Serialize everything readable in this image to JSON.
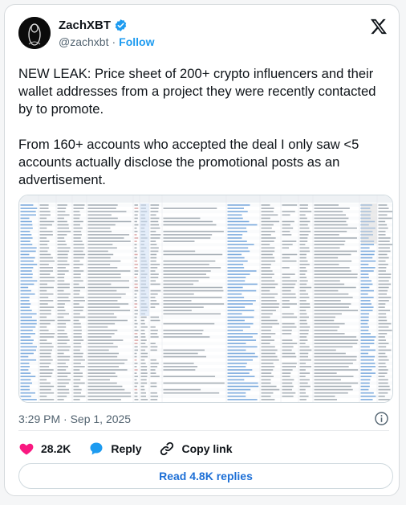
{
  "header": {
    "display_name": "ZachXBT",
    "handle": "@zachxbt",
    "separator": "·",
    "follow_label": "Follow"
  },
  "tweet": {
    "text": "NEW LEAK: Price sheet of 200+ crypto influencers and their wallet addresses from a project they were recently contacted by to promote.\n\nFrom 160+ accounts who accepted the deal I only saw <5 accounts actually disclose the promotional posts as an advertisement.",
    "timestamp": "3:29 PM · Sep 1, 2025"
  },
  "actions": {
    "likes": "28.2K",
    "reply_label": "Reply",
    "copy_link_label": "Copy link"
  },
  "replies_button": "Read 4.8K replies",
  "colors": {
    "accent": "#1d9bf0",
    "like": "#f91880",
    "verified": "#1d9bf0",
    "link_blue": "#1d6fd6"
  },
  "icons": [
    "x-logo-icon",
    "verified-badge-icon",
    "info-icon",
    "heart-icon",
    "reply-icon",
    "link-icon"
  ]
}
